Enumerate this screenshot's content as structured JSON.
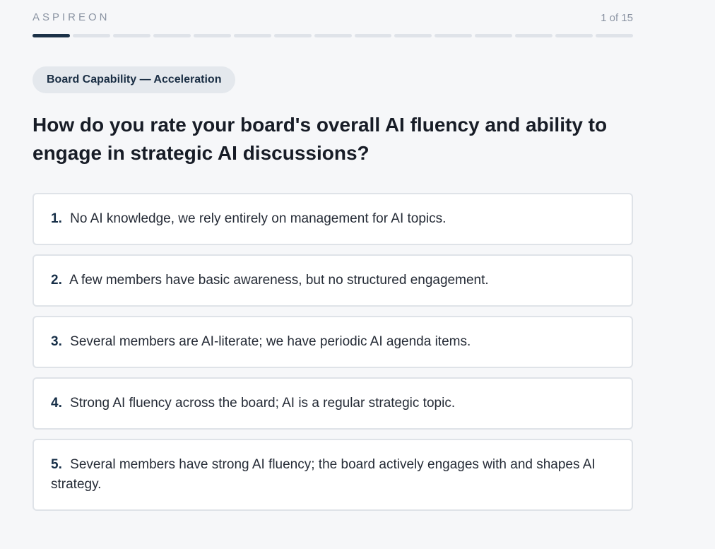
{
  "header": {
    "brand": "ASPIREON",
    "counter": "1 of 15"
  },
  "progress": {
    "current": 1,
    "total": 15
  },
  "category": "Board Capability — Acceleration",
  "question": "How do you rate your board's overall AI fluency and ability to engage in strategic AI discussions?",
  "options": [
    {
      "number": "1.",
      "text": "No AI knowledge, we rely entirely on management for AI topics."
    },
    {
      "number": "2.",
      "text": "A few members have basic awareness, but no structured engagement."
    },
    {
      "number": "3.",
      "text": "Several members are AI-literate; we have periodic AI agenda items."
    },
    {
      "number": "4.",
      "text": "Strong AI fluency across the board; AI is a regular strategic topic."
    },
    {
      "number": "5.",
      "text": "Several members have strong AI fluency; the board actively engages with and shapes AI strategy."
    }
  ],
  "colors": {
    "accent": "#1b3147",
    "track": "#dfe3e9",
    "pill_bg": "#e4e8ed",
    "background": "#f6f7f9"
  }
}
